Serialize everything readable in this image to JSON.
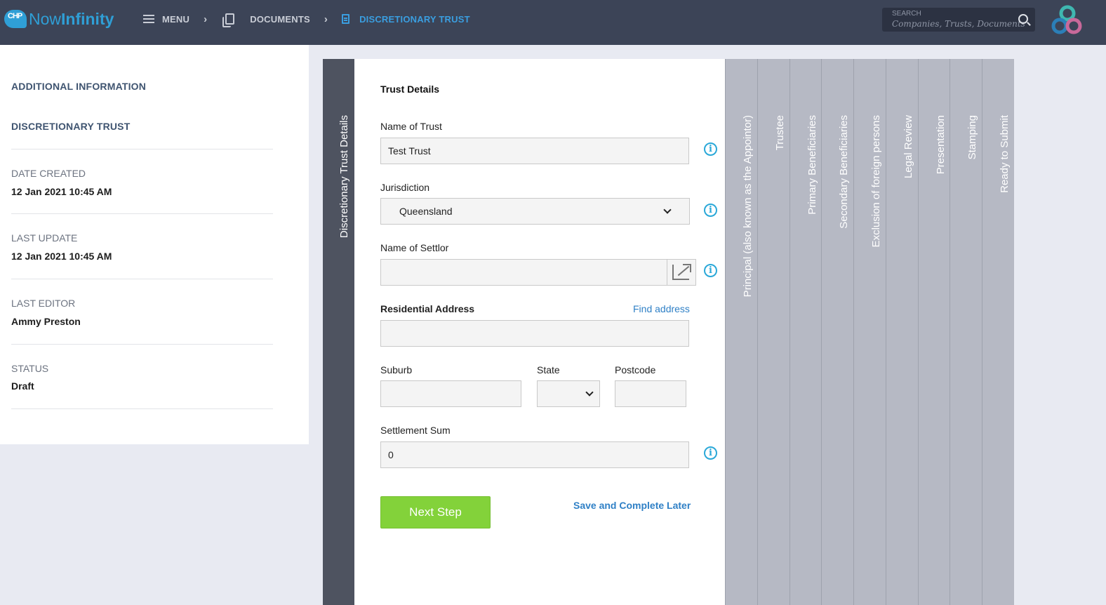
{
  "brand": {
    "badge": "CHP",
    "name_part1": "Now",
    "name_part2": "Infinity"
  },
  "nav": {
    "menu": "MENU",
    "documents": "DOCUMENTS",
    "current": "DISCRETIONARY TRUST"
  },
  "search": {
    "label": "SEARCH",
    "placeholder": "Companies,  Trusts,  Documents"
  },
  "sidebar": {
    "heading1": "ADDITIONAL INFORMATION",
    "heading2": "DISCRETIONARY TRUST",
    "date_created_label": "DATE CREATED",
    "date_created": "12 Jan 2021 10:45 AM",
    "last_update_label": "LAST UPDATE",
    "last_update": "12 Jan 2021 10:45 AM",
    "last_editor_label": "LAST EDITOR",
    "last_editor": "Ammy Preston",
    "status_label": "STATUS",
    "status": "Draft"
  },
  "wizard": {
    "active_step": "Discretionary Trust Details",
    "steps": [
      "Principal (also known as the Appointor)",
      "Trustee",
      "Primary Beneficiaries",
      "Secondary Beneficiaries",
      "Exclusion of foreign persons",
      "Legal Review",
      "Presentation",
      "Stamping",
      "Ready to Submit"
    ]
  },
  "form": {
    "section_title": "Trust Details",
    "name_of_trust_label": "Name of Trust",
    "name_of_trust": "Test Trust",
    "jurisdiction_label": "Jurisdiction",
    "jurisdiction": "Queensland",
    "settlor_label": "Name of Settlor",
    "settlor": "",
    "address_label": "Residential Address",
    "find_address": "Find address",
    "address": "",
    "suburb_label": "Suburb",
    "state_label": "State",
    "postcode_label": "Postcode",
    "settlement_label": "Settlement Sum",
    "settlement": "0",
    "next_button": "Next Step",
    "save_later": "Save and Complete Later"
  },
  "colors": {
    "topbar": "#3c4457",
    "accent": "#3a9ee0",
    "next_button": "#83d23a",
    "info": "#2aa8d8"
  }
}
